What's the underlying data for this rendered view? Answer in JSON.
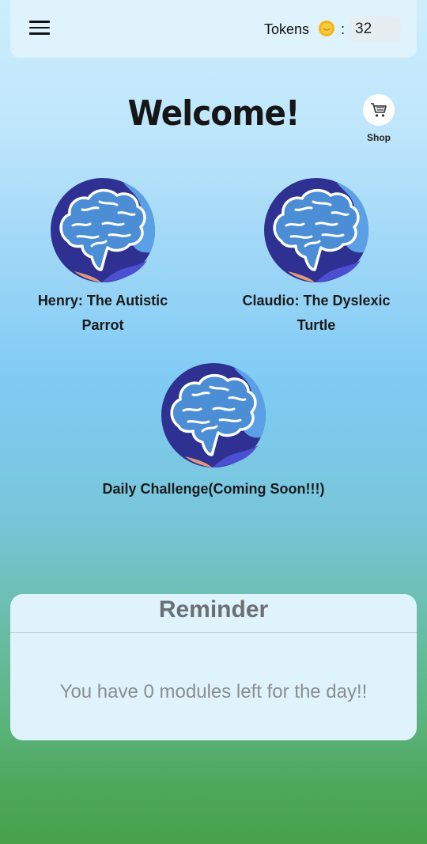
{
  "header": {
    "menu_icon": "hamburger-menu-icon",
    "tokens_label": "Tokens",
    "coin_icon": "coin-icon",
    "colon": ":",
    "token_count": "32"
  },
  "welcome": {
    "title": "Welcome!"
  },
  "shop": {
    "icon": "shopping-cart-icon",
    "label": "Shop"
  },
  "modules": [
    {
      "label_line1": "Henry: The Autistic",
      "label_line2": "Parrot",
      "icon": "brain-icon"
    },
    {
      "label_line1": "Claudio: The Dyslexic",
      "label_line2": "Turtle",
      "icon": "brain-icon"
    },
    {
      "label_line1": "Daily Challenge(Coming Soon!!!)",
      "icon": "brain-icon"
    }
  ],
  "reminder": {
    "title": "Reminder",
    "message": "You have 0 modules left for the day!!"
  },
  "colors": {
    "avatar_dark": "#2e2f8e",
    "avatar_light": "#4a8fe0",
    "top_bar": "#dff3fc"
  }
}
